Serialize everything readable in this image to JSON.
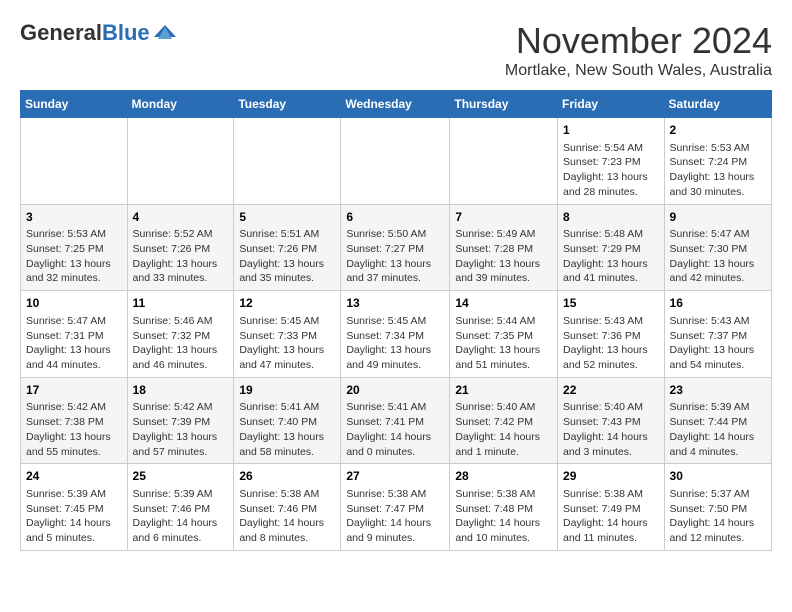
{
  "logo": {
    "general": "General",
    "blue": "Blue"
  },
  "title": {
    "month": "November 2024",
    "location": "Mortlake, New South Wales, Australia"
  },
  "headers": [
    "Sunday",
    "Monday",
    "Tuesday",
    "Wednesday",
    "Thursday",
    "Friday",
    "Saturday"
  ],
  "weeks": [
    [
      {
        "day": "",
        "info": ""
      },
      {
        "day": "",
        "info": ""
      },
      {
        "day": "",
        "info": ""
      },
      {
        "day": "",
        "info": ""
      },
      {
        "day": "",
        "info": ""
      },
      {
        "day": "1",
        "info": "Sunrise: 5:54 AM\nSunset: 7:23 PM\nDaylight: 13 hours\nand 28 minutes."
      },
      {
        "day": "2",
        "info": "Sunrise: 5:53 AM\nSunset: 7:24 PM\nDaylight: 13 hours\nand 30 minutes."
      }
    ],
    [
      {
        "day": "3",
        "info": "Sunrise: 5:53 AM\nSunset: 7:25 PM\nDaylight: 13 hours\nand 32 minutes."
      },
      {
        "day": "4",
        "info": "Sunrise: 5:52 AM\nSunset: 7:26 PM\nDaylight: 13 hours\nand 33 minutes."
      },
      {
        "day": "5",
        "info": "Sunrise: 5:51 AM\nSunset: 7:26 PM\nDaylight: 13 hours\nand 35 minutes."
      },
      {
        "day": "6",
        "info": "Sunrise: 5:50 AM\nSunset: 7:27 PM\nDaylight: 13 hours\nand 37 minutes."
      },
      {
        "day": "7",
        "info": "Sunrise: 5:49 AM\nSunset: 7:28 PM\nDaylight: 13 hours\nand 39 minutes."
      },
      {
        "day": "8",
        "info": "Sunrise: 5:48 AM\nSunset: 7:29 PM\nDaylight: 13 hours\nand 41 minutes."
      },
      {
        "day": "9",
        "info": "Sunrise: 5:47 AM\nSunset: 7:30 PM\nDaylight: 13 hours\nand 42 minutes."
      }
    ],
    [
      {
        "day": "10",
        "info": "Sunrise: 5:47 AM\nSunset: 7:31 PM\nDaylight: 13 hours\nand 44 minutes."
      },
      {
        "day": "11",
        "info": "Sunrise: 5:46 AM\nSunset: 7:32 PM\nDaylight: 13 hours\nand 46 minutes."
      },
      {
        "day": "12",
        "info": "Sunrise: 5:45 AM\nSunset: 7:33 PM\nDaylight: 13 hours\nand 47 minutes."
      },
      {
        "day": "13",
        "info": "Sunrise: 5:45 AM\nSunset: 7:34 PM\nDaylight: 13 hours\nand 49 minutes."
      },
      {
        "day": "14",
        "info": "Sunrise: 5:44 AM\nSunset: 7:35 PM\nDaylight: 13 hours\nand 51 minutes."
      },
      {
        "day": "15",
        "info": "Sunrise: 5:43 AM\nSunset: 7:36 PM\nDaylight: 13 hours\nand 52 minutes."
      },
      {
        "day": "16",
        "info": "Sunrise: 5:43 AM\nSunset: 7:37 PM\nDaylight: 13 hours\nand 54 minutes."
      }
    ],
    [
      {
        "day": "17",
        "info": "Sunrise: 5:42 AM\nSunset: 7:38 PM\nDaylight: 13 hours\nand 55 minutes."
      },
      {
        "day": "18",
        "info": "Sunrise: 5:42 AM\nSunset: 7:39 PM\nDaylight: 13 hours\nand 57 minutes."
      },
      {
        "day": "19",
        "info": "Sunrise: 5:41 AM\nSunset: 7:40 PM\nDaylight: 13 hours\nand 58 minutes."
      },
      {
        "day": "20",
        "info": "Sunrise: 5:41 AM\nSunset: 7:41 PM\nDaylight: 14 hours\nand 0 minutes."
      },
      {
        "day": "21",
        "info": "Sunrise: 5:40 AM\nSunset: 7:42 PM\nDaylight: 14 hours\nand 1 minute."
      },
      {
        "day": "22",
        "info": "Sunrise: 5:40 AM\nSunset: 7:43 PM\nDaylight: 14 hours\nand 3 minutes."
      },
      {
        "day": "23",
        "info": "Sunrise: 5:39 AM\nSunset: 7:44 PM\nDaylight: 14 hours\nand 4 minutes."
      }
    ],
    [
      {
        "day": "24",
        "info": "Sunrise: 5:39 AM\nSunset: 7:45 PM\nDaylight: 14 hours\nand 5 minutes."
      },
      {
        "day": "25",
        "info": "Sunrise: 5:39 AM\nSunset: 7:46 PM\nDaylight: 14 hours\nand 6 minutes."
      },
      {
        "day": "26",
        "info": "Sunrise: 5:38 AM\nSunset: 7:46 PM\nDaylight: 14 hours\nand 8 minutes."
      },
      {
        "day": "27",
        "info": "Sunrise: 5:38 AM\nSunset: 7:47 PM\nDaylight: 14 hours\nand 9 minutes."
      },
      {
        "day": "28",
        "info": "Sunrise: 5:38 AM\nSunset: 7:48 PM\nDaylight: 14 hours\nand 10 minutes."
      },
      {
        "day": "29",
        "info": "Sunrise: 5:38 AM\nSunset: 7:49 PM\nDaylight: 14 hours\nand 11 minutes."
      },
      {
        "day": "30",
        "info": "Sunrise: 5:37 AM\nSunset: 7:50 PM\nDaylight: 14 hours\nand 12 minutes."
      }
    ]
  ]
}
